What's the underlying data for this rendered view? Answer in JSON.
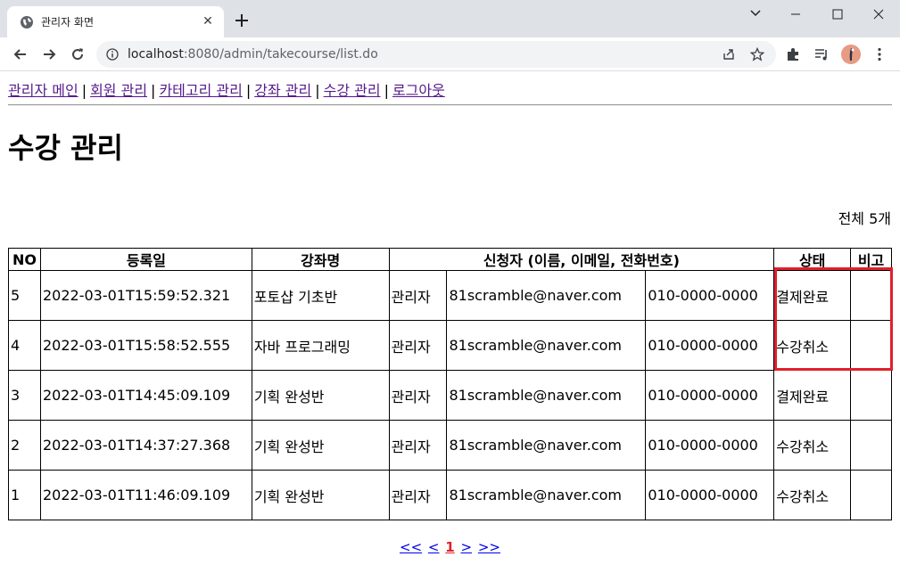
{
  "browser": {
    "tab_title": "관리자 화면",
    "url_host": "localhost",
    "url_rest": ":8080/admin/takecourse/list.do"
  },
  "nav": {
    "items": [
      "관리자 메인",
      "회원 관리",
      "카테고리 관리",
      "강좌 관리",
      "수강 관리",
      "로그아웃"
    ],
    "separator": "|"
  },
  "page": {
    "title": "수강 관리",
    "total": "전체 5개"
  },
  "table": {
    "headers": {
      "no": "NO",
      "reg_date": "등록일",
      "course": "강좌명",
      "applicant": "신청자 (이름, 이메일, 전화번호)",
      "status": "상태",
      "note": "비고"
    },
    "rows": [
      {
        "no": "5",
        "reg_date": "2022-03-01T15:59:52.321",
        "course": "포토샵 기초반",
        "name": "관리자",
        "email": "81scramble@naver.com",
        "phone": "010-0000-0000",
        "status": "결제완료",
        "note": ""
      },
      {
        "no": "4",
        "reg_date": "2022-03-01T15:58:52.555",
        "course": "자바 프로그래밍",
        "name": "관리자",
        "email": "81scramble@naver.com",
        "phone": "010-0000-0000",
        "status": "수강취소",
        "note": ""
      },
      {
        "no": "3",
        "reg_date": "2022-03-01T14:45:09.109",
        "course": "기획 완성반",
        "name": "관리자",
        "email": "81scramble@naver.com",
        "phone": "010-0000-0000",
        "status": "결제완료",
        "note": ""
      },
      {
        "no": "2",
        "reg_date": "2022-03-01T14:37:27.368",
        "course": "기획 완성반",
        "name": "관리자",
        "email": "81scramble@naver.com",
        "phone": "010-0000-0000",
        "status": "수강취소",
        "note": ""
      },
      {
        "no": "1",
        "reg_date": "2022-03-01T11:46:09.109",
        "course": "기획 완성반",
        "name": "관리자",
        "email": "81scramble@naver.com",
        "phone": "010-0000-0000",
        "status": "수강취소",
        "note": ""
      }
    ]
  },
  "pager": {
    "first": "<<",
    "prev": "<",
    "current": "1",
    "next": ">",
    "last": ">>"
  },
  "colors": {
    "highlight": "#e0202c",
    "link_visited": "#551a8b",
    "link": "#0000ee"
  }
}
